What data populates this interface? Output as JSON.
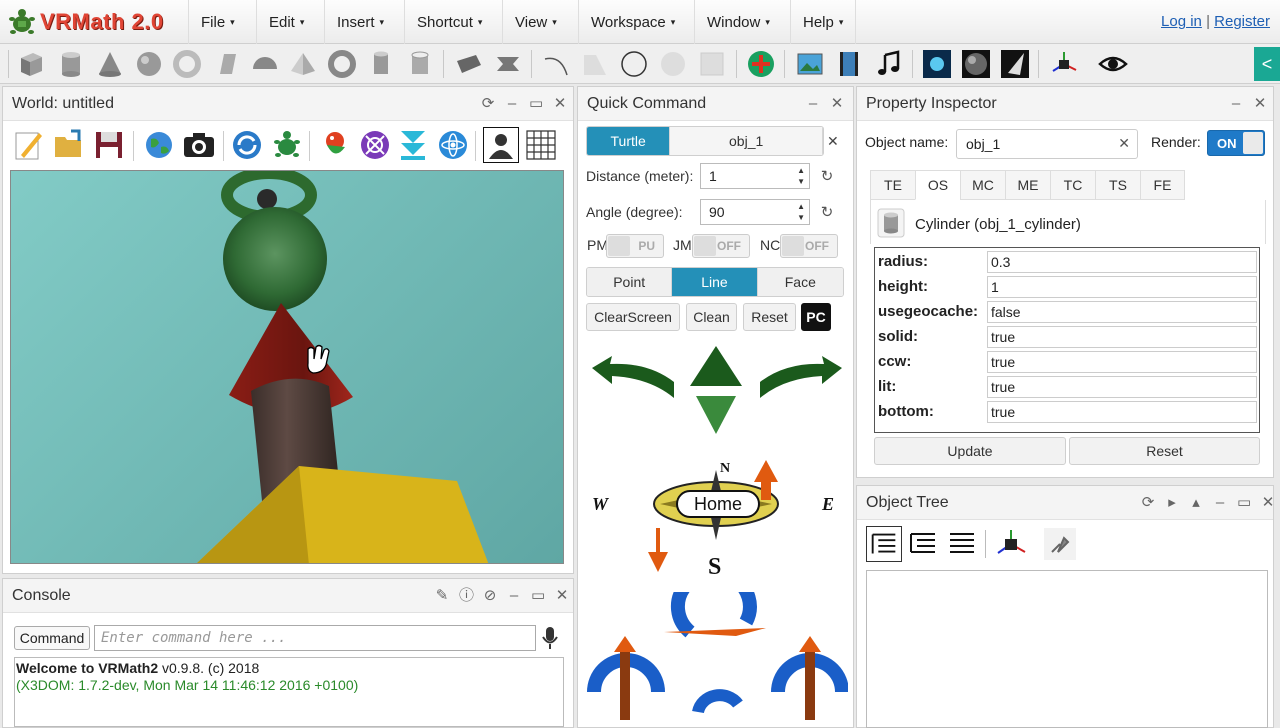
{
  "app": {
    "logo_text": "VRMath 2.0"
  },
  "menubar": {
    "items": [
      "File",
      "Edit",
      "Insert",
      "Shortcut",
      "View",
      "Workspace",
      "Window",
      "Help"
    ],
    "caret": "▾",
    "login": "Log in",
    "separator": "|",
    "register": "Register"
  },
  "toolbar": {
    "icons": [
      "box-icon",
      "cylinder-icon",
      "cone-icon",
      "sphere-icon",
      "torus-icon",
      "extrusion-icon",
      "hemisphere-icon",
      "pyramid-icon",
      "ring-icon",
      "tube-icon",
      "pipe-icon",
      "plane-icon",
      "prism-icon",
      "arc-icon",
      "disk-segment-icon",
      "circle-icon",
      "disk-icon",
      "rectangle-icon",
      "add-object-icon",
      "image-icon",
      "video-icon",
      "music-icon",
      "background-icon",
      "texture-icon",
      "light-icon",
      "axis-icon",
      "eye-icon"
    ],
    "collapse_glyph": "<"
  },
  "world": {
    "title": "World: untitled",
    "tools": [
      "edit-icon",
      "open-icon",
      "save-icon",
      "globe-icon",
      "camera-icon",
      "refresh-icon",
      "turtle-icon",
      "parrot-icon",
      "atom-spin-icon",
      "download-arrows-icon",
      "atom-icon",
      "avatar-icon",
      "grid-icon"
    ]
  },
  "console": {
    "title": "Console",
    "command_label": "Command",
    "placeholder": "Enter command here ...",
    "welcome_bold": "Welcome to VRMath2",
    "welcome_rest": " v0.9.8. (c) 2018",
    "x3dom_line": "(X3DOM: 1.7.2-dev, Mon Mar 14 11:46:12 2016 +0100)"
  },
  "quick_command": {
    "title": "Quick Command",
    "tab_turtle": "Turtle",
    "tab_object": "obj_1",
    "distance_label": "Distance (meter):",
    "distance_value": "1",
    "angle_label": "Angle (degree):",
    "angle_value": "90",
    "pm_label": "PM",
    "pm_state": "PU",
    "jm_label": "JM",
    "jm_state": "OFF",
    "nc_label": "NC",
    "nc_state": "OFF",
    "mode_point": "Point",
    "mode_line": "Line",
    "mode_face": "Face",
    "clearscreen": "ClearScreen",
    "clean": "Clean",
    "reset": "Reset",
    "pc": "PC",
    "home": "Home",
    "compass_n": "N",
    "compass_s": "S",
    "compass_w": "W",
    "compass_e": "E"
  },
  "property_inspector": {
    "title": "Property Inspector",
    "object_name_label": "Object name:",
    "object_name_value": "obj_1",
    "render_label": "Render:",
    "render_state": "ON",
    "tabs": [
      "TE",
      "OS",
      "MC",
      "ME",
      "TC",
      "TS",
      "FE"
    ],
    "active_tab": "OS",
    "node_title": "Cylinder (obj_1_cylinder)",
    "properties": [
      {
        "key": "radius:",
        "value": "0.3"
      },
      {
        "key": "height:",
        "value": "1"
      },
      {
        "key": "usegeocache:",
        "value": "false"
      },
      {
        "key": "solid:",
        "value": "true"
      },
      {
        "key": "ccw:",
        "value": "true"
      },
      {
        "key": "lit:",
        "value": "true"
      },
      {
        "key": "bottom:",
        "value": "true"
      }
    ],
    "update": "Update",
    "reset": "Reset"
  },
  "object_tree": {
    "title": "Object Tree",
    "tools": [
      "expand-all-icon",
      "collapse-icon",
      "list-icon",
      "axis-icon",
      "pointer-icon"
    ]
  },
  "colors": {
    "accent": "#2490b8",
    "teal": "#1aa894",
    "logo": "#e04535"
  }
}
